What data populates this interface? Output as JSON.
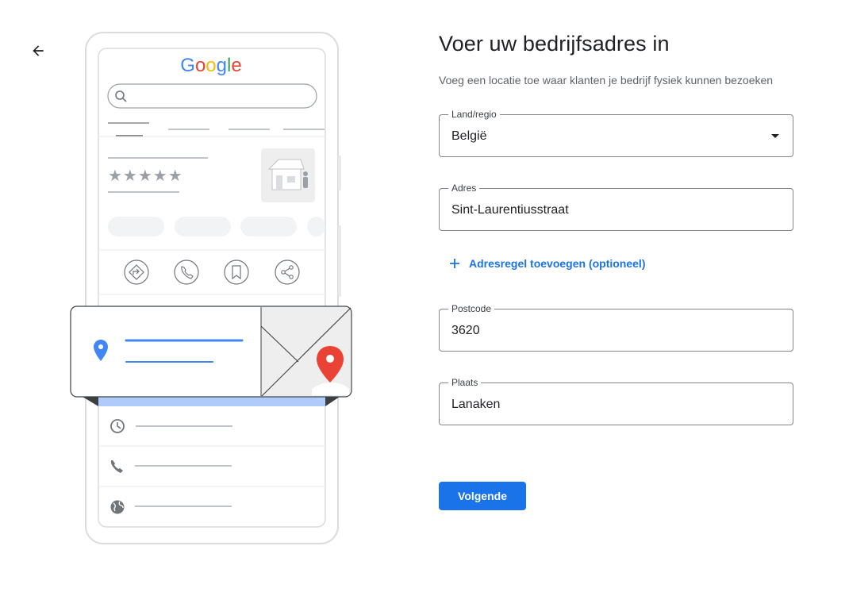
{
  "icons": {
    "back": "arrow-left-icon"
  },
  "illustration": {
    "logo_text": "Google",
    "logo_colors": [
      "#4285F4",
      "#EA4335",
      "#FBBC05",
      "#4285F4",
      "#34A853",
      "#EA4335"
    ],
    "stars": "★★★★★"
  },
  "form": {
    "title": "Voer uw bedrijfsadres in",
    "subtitle": "Voeg een locatie toe waar klanten je bedrijf fysiek kunnen bezoeken",
    "country": {
      "label": "Land/regio",
      "value": "België"
    },
    "address": {
      "label": "Adres",
      "value": "Sint-Laurentiusstraat"
    },
    "add_line": {
      "icon": "plus-icon",
      "label": "Adresregel toevoegen (optioneel)"
    },
    "postcode": {
      "label": "Postcode",
      "value": "3620"
    },
    "city": {
      "label": "Plaats",
      "value": "Lanaken"
    },
    "next_label": "Volgende"
  },
  "colors": {
    "accent": "#1a73e8",
    "text": "#202124",
    "muted": "#5f6368",
    "border": "#80868b",
    "pin_red": "#EA4335"
  }
}
